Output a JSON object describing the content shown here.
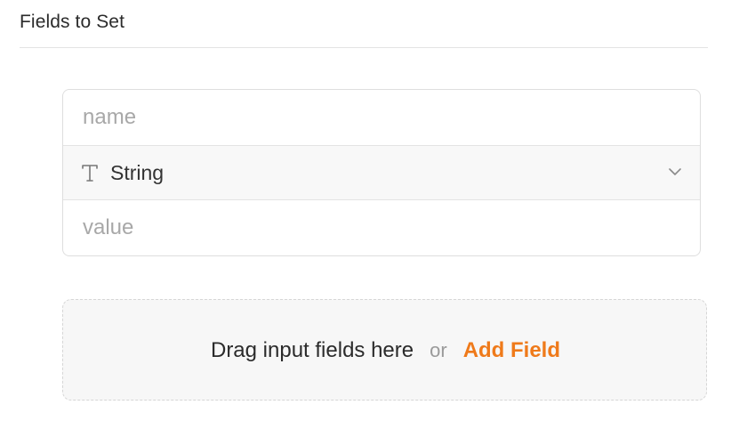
{
  "section": {
    "title": "Fields to Set"
  },
  "field": {
    "name_placeholder": "name",
    "type_label": "String",
    "type_icon": "text-type-icon",
    "value_placeholder": "value"
  },
  "drop_zone": {
    "text": "Drag input fields here",
    "separator": "or",
    "add_label": "Add Field"
  },
  "colors": {
    "accent": "#ef7a1a",
    "border": "#dedede",
    "placeholder": "#a8a8a8"
  }
}
